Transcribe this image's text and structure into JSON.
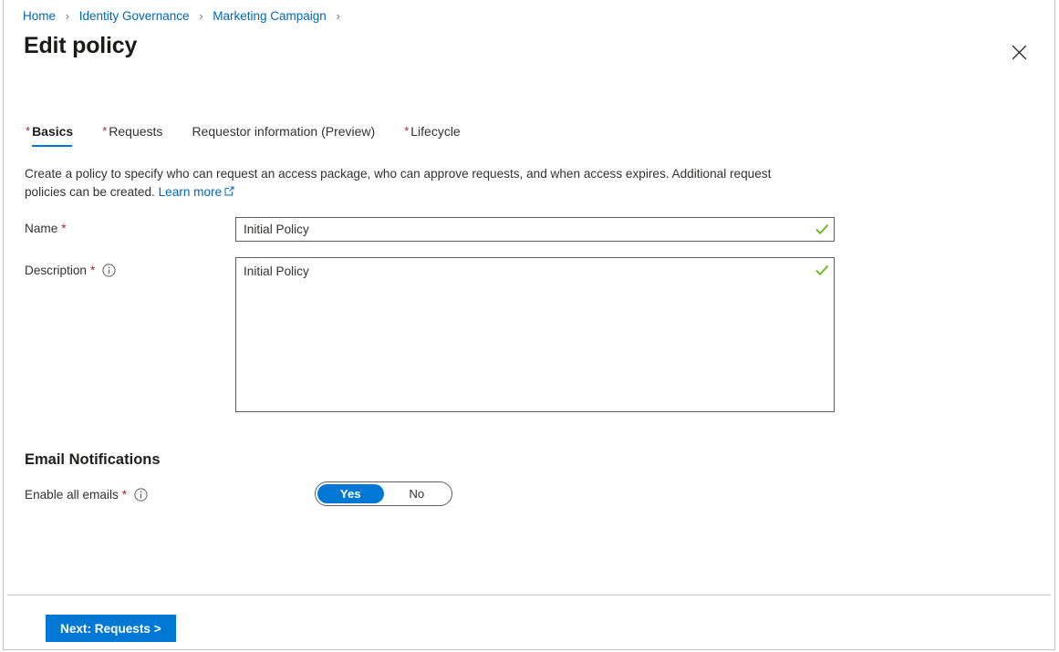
{
  "breadcrumb": {
    "separator": "›",
    "items": [
      {
        "label": "Home"
      },
      {
        "label": "Identity Governance"
      },
      {
        "label": "Marketing Campaign"
      }
    ]
  },
  "header": {
    "title": "Edit policy",
    "close_icon": "close-icon"
  },
  "tabs": [
    {
      "label": "Basics",
      "required": "*",
      "active": true
    },
    {
      "label": "Requests",
      "required": "*",
      "active": false
    },
    {
      "label": "Requestor information (Preview)",
      "required": "",
      "active": false
    },
    {
      "label": "Lifecycle",
      "required": "*",
      "active": false
    }
  ],
  "intro": {
    "text": "Create a policy to specify who can request an access package, who can approve requests, and when access expires. Additional request policies can be created.",
    "link_label": "Learn more",
    "link_icon": "external-link-icon"
  },
  "form": {
    "name": {
      "label": "Name",
      "required": "*",
      "value": "Initial Policy",
      "placeholder": "",
      "valid_icon": "checkmark-icon"
    },
    "description": {
      "label": "Description",
      "required": "*",
      "info_icon": "info-icon",
      "value": "Initial Policy",
      "placeholder": "",
      "valid_icon": "checkmark-icon"
    }
  },
  "email_notifications": {
    "heading": "Email Notifications",
    "toggle": {
      "label": "Enable all emails",
      "required": "*",
      "info_icon": "info-icon",
      "options": [
        {
          "label": "Yes",
          "selected": true
        },
        {
          "label": "No",
          "selected": false
        }
      ]
    }
  },
  "footer": {
    "next_label": "Next: Requests >"
  },
  "colors": {
    "accent": "#0078d4",
    "link": "#0067b8",
    "required_star": "#a4262c",
    "valid_check": "#5db300",
    "border": "#c8c6c4"
  }
}
